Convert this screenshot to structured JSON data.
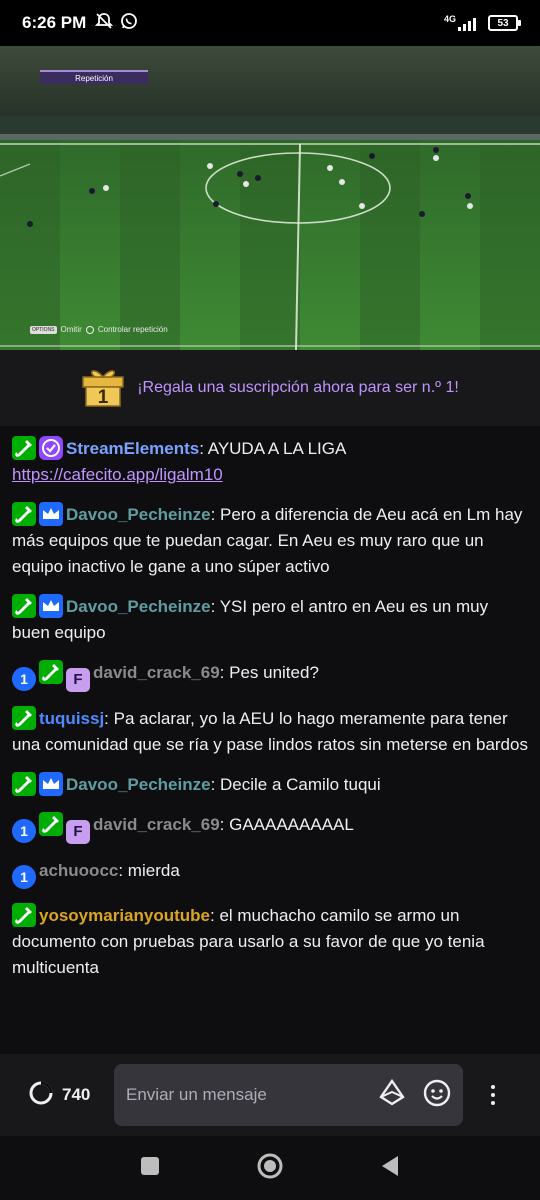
{
  "status_bar": {
    "time": "6:26 PM",
    "network": "4G",
    "battery": "53"
  },
  "video": {
    "replay_label": "Repetición",
    "controls": {
      "chip": "OPTIONS",
      "skip_label": "Omitir",
      "control_label": "Controlar repetición"
    }
  },
  "sub_banner": {
    "badge_number": "1",
    "text": "¡Regala una suscripción ahora para ser n.º 1!"
  },
  "chat": {
    "messages": [
      {
        "user": "StreamElements",
        "user_color": "#7aa2ff",
        "badges": [
          "mod-icon",
          "verified-icon"
        ],
        "text": ": AYUDA A LA LIGA      ",
        "link": "https://cafecito.app/ligalm10"
      },
      {
        "user": "Davoo_Pecheinze",
        "user_color": "#5f9ea0",
        "badges": [
          "mod-icon",
          "crown-icon"
        ],
        "text": ": Pero a diferencia de Aeu acá en Lm hay más equipos que te puedan cagar. En Aeu es muy raro que un equipo inactivo le gane a uno súper activo"
      },
      {
        "user": "Davoo_Pecheinze",
        "user_color": "#5f9ea0",
        "badges": [
          "mod-icon",
          "crown-icon"
        ],
        "text": ": YSI pero el antro en Aeu es un muy buen equipo"
      },
      {
        "user": "david_crack_69",
        "user_color": "#8a8a8a",
        "badges": [
          "one-badge",
          "mod-icon",
          "sub-badge"
        ],
        "text": ": Pes united?"
      },
      {
        "user": "tuquissj",
        "user_color": "#4f8bff",
        "badges": [
          "mod-icon"
        ],
        "text": ": Pa aclarar, yo la AEU lo hago meramente para tener una comunidad que se ría y pase lindos ratos sin meterse en bardos"
      },
      {
        "user": "Davoo_Pecheinze",
        "user_color": "#5f9ea0",
        "badges": [
          "mod-icon",
          "crown-icon"
        ],
        "text": ": Decile a Camilo tuqui"
      },
      {
        "user": "david_crack_69",
        "user_color": "#8a8a8a",
        "badges": [
          "one-badge",
          "mod-icon",
          "sub-badge"
        ],
        "text": ": GAAAAAAAAAL"
      },
      {
        "user": "achuoocc",
        "user_color": "#8a8a8a",
        "badges": [
          "one-badge"
        ],
        "text": ": mierda"
      },
      {
        "user": "yosoymarianyoutube",
        "user_color": "#daa520",
        "badges": [
          "mod-icon"
        ],
        "text": ": el muchacho camilo se armo un documento con pruebas para usarlo a su favor de que yo tenia multicuenta"
      }
    ]
  },
  "input_bar": {
    "viewer_count": "740",
    "placeholder": "Enviar un mensaje"
  },
  "colors": {
    "background": "#0e0e10",
    "accent": "#bf94ff",
    "mod_green": "#00ad03"
  }
}
